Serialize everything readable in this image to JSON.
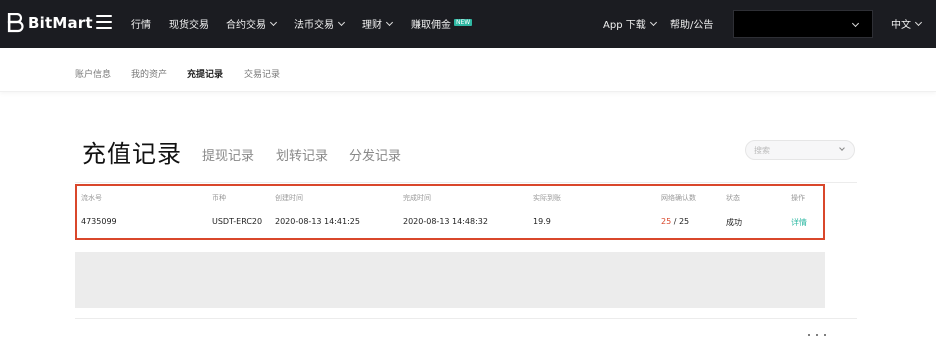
{
  "brand": {
    "name": "BitMart"
  },
  "nav": {
    "items": [
      {
        "label": "行情"
      },
      {
        "label": "现货交易"
      },
      {
        "label": "合约交易"
      },
      {
        "label": "法币交易"
      },
      {
        "label": "理财"
      },
      {
        "label": "赚取佣金",
        "badge": "NEW"
      }
    ],
    "app_download": "App 下载",
    "help": "帮助/公告",
    "language": "中文"
  },
  "subnav": {
    "items": [
      {
        "label": "账户信息"
      },
      {
        "label": "我的资产"
      },
      {
        "label": "充提记录",
        "active": true
      },
      {
        "label": "交易记录"
      }
    ]
  },
  "page": {
    "title": "充值记录",
    "tabs": [
      {
        "label": "提现记录"
      },
      {
        "label": "划转记录"
      },
      {
        "label": "分发记录"
      }
    ],
    "search_placeholder": "搜索"
  },
  "table": {
    "headers": [
      "流水号",
      "币种",
      "创建时间",
      "完成时间",
      "实际到账",
      "网络确认数",
      "状态",
      "操作"
    ],
    "rows": [
      {
        "id": "4735099",
        "currency": "USDT-ERC20",
        "created": "2020-08-13 14:41:25",
        "completed": "2020-08-13 14:48:32",
        "amount": "19.9",
        "confirmations_done": "25",
        "confirmations_sep": " / ",
        "confirmations_total": "25",
        "status": "成功",
        "action": "详情"
      }
    ]
  },
  "colors": {
    "nav_bg": "#1b1c21",
    "accent_teal": "#2fb8a3",
    "highlight_red": "#d9472b"
  }
}
